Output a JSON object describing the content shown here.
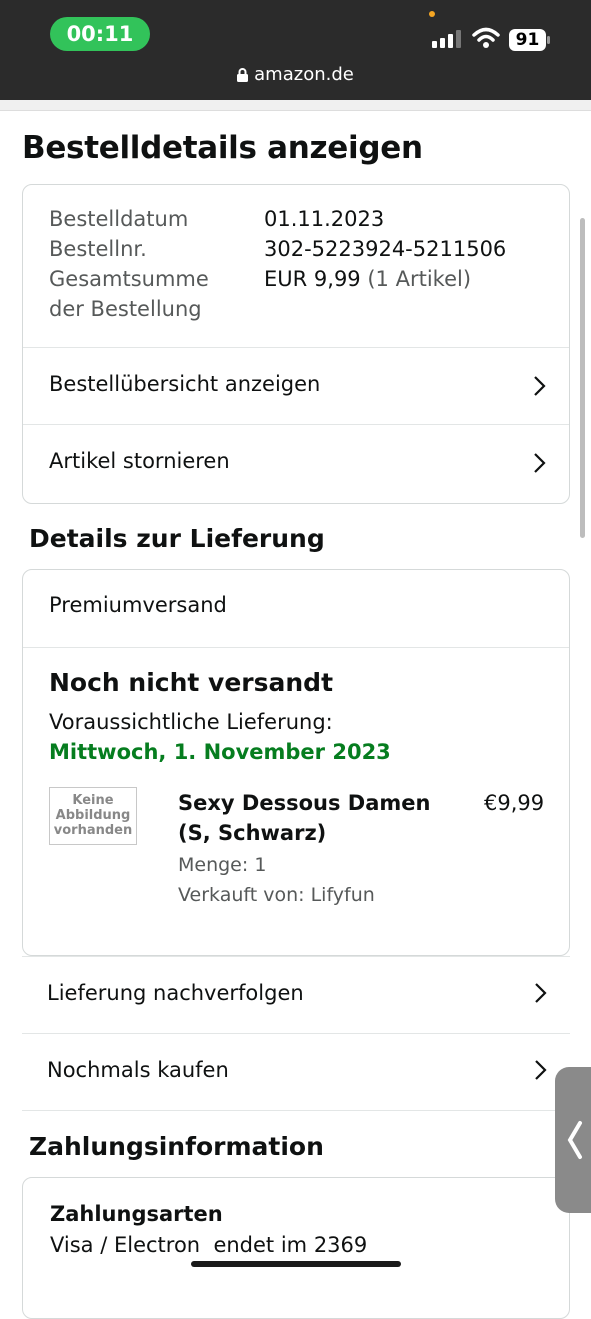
{
  "status_bar": {
    "time": "00:11",
    "battery": "91",
    "url": "amazon.de"
  },
  "page": {
    "title": "Bestelldetails anzeigen"
  },
  "order_info": {
    "date_label": "Bestelldatum",
    "date_value": "01.11.2023",
    "number_label": "Bestellnr.",
    "number_value": "302-5223924-5211506",
    "total_label_line1": "Gesamtsumme",
    "total_label_line2": "der Bestellung",
    "total_value": "EUR 9,99",
    "total_count": "(1 Artikel)"
  },
  "order_links": {
    "overview": "Bestellübersicht anzeigen",
    "cancel": "Artikel stornieren"
  },
  "delivery": {
    "section_title": "Details zur Lieferung",
    "shipping_type": "Premiumversand",
    "status": "Noch nicht versandt",
    "expected_label": "Voraussichtliche Lieferung:",
    "expected_date": "Mittwoch, 1. November 2023",
    "item": {
      "image_placeholder_1": "Keine",
      "image_placeholder_2": "Abbildung",
      "image_placeholder_3": "vorhanden",
      "title_line1": "Sexy Dessous Damen",
      "title_line2": "(S, Schwarz)",
      "price": "€9,99",
      "quantity": "Menge: 1",
      "seller": "Verkauft von: Lifyfun"
    },
    "track": "Lieferung nachverfolgen",
    "buy_again": "Nochmals kaufen"
  },
  "payment": {
    "section_title": "Zahlungsinformation",
    "methods_title": "Zahlungsarten",
    "method_value": "Visa / Electron  endet im 2369"
  },
  "colors": {
    "accent_green": "#067d1f",
    "status_pill": "#32c35a",
    "header_bg": "#2b2b2b"
  }
}
